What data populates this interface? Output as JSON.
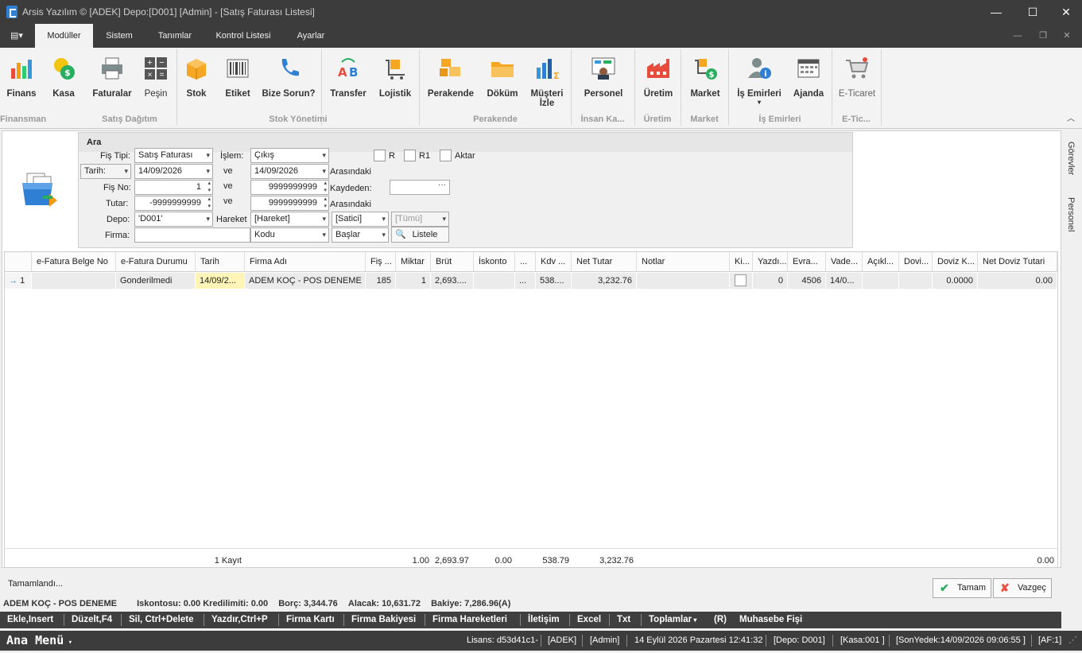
{
  "window": {
    "title": "Arsis Yazılım © [ADEK] Depo:[D001] [Admin] - [Satış Faturası Listesi]",
    "minimize": "—",
    "maximize": "☐",
    "close": "✕"
  },
  "tabs": [
    "Modüller",
    "Sistem",
    "Tanımlar",
    "Kontrol Listesi",
    "Ayarlar"
  ],
  "ribbon": {
    "buttons": [
      "Finans",
      "Kasa",
      "Faturalar",
      "Peşin",
      "Stok",
      "Etiket",
      "Bize Sorun?",
      "Transfer",
      "Lojistik",
      "Perakende",
      "Döküm",
      "Müşteri İzle",
      "Personel",
      "Üretim",
      "Market",
      "İş Emirleri",
      "Ajanda",
      "E-Ticaret"
    ],
    "groups": [
      "Finansman",
      "Satış Dağıtım",
      "Stok Yönetimi",
      "Perakende",
      "İnsan Ka...",
      "Üretim",
      "Market",
      "İş Emirleri",
      "E-Tic..."
    ]
  },
  "side_tabs": [
    "Görevler",
    "Personel"
  ],
  "search": {
    "header": "Ara",
    "fis_tipi_label": "Fiş Tipi:",
    "fis_tipi": "Satış Faturası",
    "islem_label": "İşlem:",
    "islem": "Çıkış",
    "chk_r": "R",
    "chk_r1": "R1",
    "chk_aktar": "Aktar",
    "tarih_label": "Tarih:",
    "tarih_from": "14/09/2026",
    "ve": "ve",
    "tarih_to": "14/09/2026",
    "arasindaki": "Arasındaki",
    "fis_no_label": "Fiş No:",
    "fis_no_from": "1",
    "fis_no_to": "9999999999",
    "kaydeden_label": "Kaydeden:",
    "kaydeden_btn": "···",
    "tutar_label": "Tutar:",
    "tutar_from": "-9999999999",
    "tutar_to": "9999999999",
    "depo_label": "Depo:",
    "depo": "'D001'",
    "hareket_label": "Hareket",
    "hareket": "[Hareket]",
    "satici": "[Satici]",
    "tumu": "[Tümü]",
    "firma_label": "Firma:",
    "kodu": "Kodu",
    "baslar": "Başlar",
    "listele": "Listele"
  },
  "grid": {
    "columns": [
      "e-Fatura Belge No",
      "e-Fatura Durumu",
      "Tarih",
      "Firma Adı",
      "Fiş ...",
      "Miktar",
      "Brüt",
      "İskonto",
      "...",
      "Kdv ...",
      "Net Tutar",
      "Notlar",
      "Ki...",
      "Yazdı...",
      "Evra...",
      "Vade...",
      "Açıkl...",
      "Dovi...",
      "Doviz K...",
      "Net Doviz Tutari"
    ],
    "rows": [
      {
        "num": "1",
        "efatura_no": "",
        "efatura_durum": "Gonderilmedi",
        "tarih": "14/09/2...",
        "firma": "ADEM KOÇ - POS DENEME",
        "fis": "185",
        "miktar": "1",
        "brut": "2,693....",
        "iskonto": "",
        "dots": "...",
        "kdv": "538....",
        "net": "3,232.76",
        "notlar": "",
        "yazdi": "0",
        "evrak": "4506",
        "vade": "14/0...",
        "aciklama": "",
        "doviz": "",
        "doviz_kur": "0.0000",
        "net_doviz": "0.00"
      }
    ],
    "footer": {
      "kayit": "1 Kayıt",
      "miktar": "1.00",
      "brut": "2,693.97",
      "iskonto": "0.00",
      "kdv": "538.79",
      "net": "3,232.76",
      "net_doviz": "0.00"
    }
  },
  "status": "Tamamlandı...",
  "ok_button": "Tamam",
  "cancel_button": "Vazgeç",
  "info": {
    "firma": "ADEM KOÇ - POS DENEME",
    "iskonto": "Iskontosu: 0.00",
    "kredi": "Kredilimiti: 0.00",
    "borc": "Borç: 3,344.76",
    "alacak": "Alacak: 10,631.72",
    "bakiye": "Bakiye: 7,286.96(A)"
  },
  "actions": [
    "Ekle,Insert",
    "Düzelt,F4",
    "Sil, Ctrl+Delete",
    "Yazdır,Ctrl+P",
    "Firma Kartı",
    "Firma Bakiyesi",
    "Firma Hareketleri",
    "İletişim",
    "Excel",
    "Txt",
    "Toplamlar",
    "(R)",
    "Muhasebe Fişi"
  ],
  "bottom": {
    "menu": "Ana Menü",
    "lisans": "Lisans: d53d41c1-",
    "firma": "[ADEK]",
    "user": "[Admin]",
    "date": "14 Eylül 2026 Pazartesi 12:41:32",
    "depo": "[Depo: D001]",
    "kasa": "[Kasa:001 ]",
    "yedek": "[SonYedek:14/09/2026 09:06:55 ]",
    "af": "[AF:1]"
  }
}
